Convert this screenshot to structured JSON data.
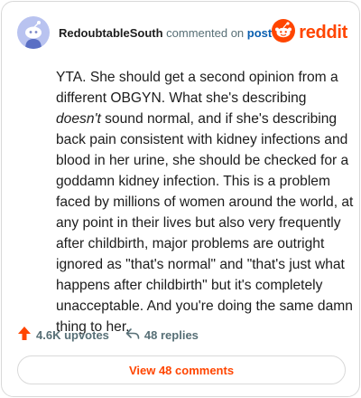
{
  "header": {
    "username": "RedoubtableSouth",
    "verb": " commented on ",
    "target": "post",
    "brand": "reddit"
  },
  "comment": {
    "part1": "YTA. She should get a second opinion from a different OBGYN. What she's describing ",
    "emphasis": "doesn't",
    "part2": " sound normal, and if she's describing back pain consistent with kidney infections and blood in her urine, she should be checked for a goddamn kidney infection. This is a problem faced by millions of women around the world, at any point in their lives but also very frequently after childbirth, major problems are outright ignored as \"that's normal\" and \"that's just what happens after childbirth\" but it's completely unacceptable. And you're doing the same damn thing to her."
  },
  "actions": {
    "upvotes": "4.6K upvotes",
    "replies": "48 replies"
  },
  "footer": {
    "view_comments": "View 48 comments"
  },
  "colors": {
    "accent": "#ff4500",
    "avatar_bg": "#b9c3f0",
    "link": "#0a5fb0"
  },
  "icons": {
    "avatar": "snoo-avatar-icon",
    "brand": "reddit-logo-icon",
    "upvote": "upvote-arrow-icon",
    "reply": "reply-arrow-icon"
  }
}
